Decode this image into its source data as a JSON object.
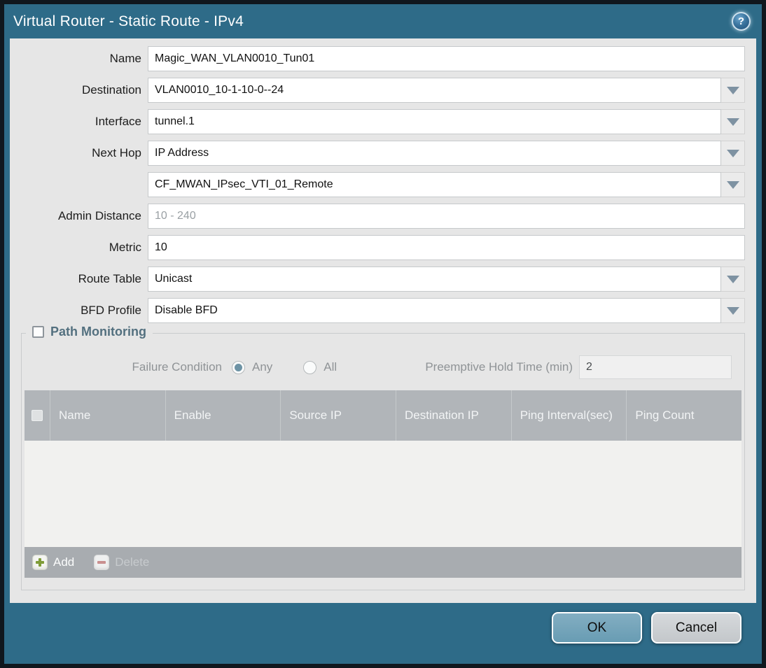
{
  "window": {
    "title": "Virtual Router - Static Route - IPv4",
    "help_icon": "?"
  },
  "colors": {
    "titlebar_teal": "#2e6b88",
    "content_bg": "#e6e6e6",
    "table_header_bg": "#b1b5b9",
    "ok_button": "#72a3b9",
    "cancel_button": "#c9cdd0",
    "add_icon_green": "#7f9c37",
    "delete_icon_red": "#c98f8f",
    "group_title": "#53707f"
  },
  "form": {
    "name": {
      "label": "Name",
      "value": "Magic_WAN_VLAN0010_Tun01"
    },
    "destination": {
      "label": "Destination",
      "value": "VLAN0010_10-1-10-0--24"
    },
    "interface": {
      "label": "Interface",
      "value": "tunnel.1"
    },
    "next_hop": {
      "label": "Next Hop",
      "value": "IP Address"
    },
    "next_hop_address": {
      "value": "CF_MWAN_IPsec_VTI_01_Remote"
    },
    "admin_distance": {
      "label": "Admin Distance",
      "value": "",
      "placeholder": "10 - 240"
    },
    "metric": {
      "label": "Metric",
      "value": "10"
    },
    "route_table": {
      "label": "Route Table",
      "value": "Unicast"
    },
    "bfd_profile": {
      "label": "BFD Profile",
      "value": "Disable BFD"
    }
  },
  "path_monitoring": {
    "title": "Path Monitoring",
    "checked": false,
    "failure_condition": {
      "label": "Failure Condition",
      "options": [
        {
          "label": "Any",
          "selected": true
        },
        {
          "label": "All",
          "selected": false
        }
      ]
    },
    "preemptive_hold_time": {
      "label": "Preemptive Hold Time (min)",
      "value": "2"
    },
    "table": {
      "headers": [
        "Name",
        "Enable",
        "Source IP",
        "Destination IP",
        "Ping Interval(sec)",
        "Ping Count"
      ],
      "rows": []
    },
    "add_label": "Add",
    "delete_label": "Delete"
  },
  "footer": {
    "ok_label": "OK",
    "cancel_label": "Cancel"
  }
}
